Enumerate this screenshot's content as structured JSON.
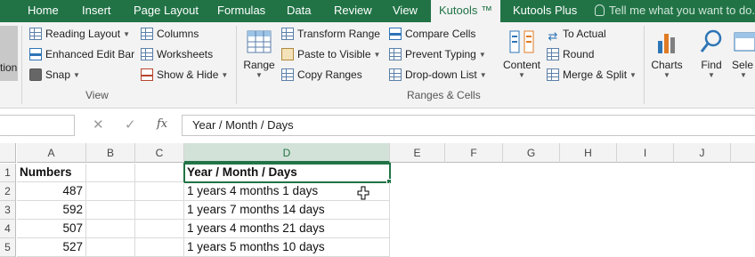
{
  "tabs": [
    "Home",
    "Insert",
    "Page Layout",
    "Formulas",
    "Data",
    "Review",
    "View",
    "Kutools ™",
    "Kutools Plus"
  ],
  "active_tab": "Kutools ™",
  "tell_me": "Tell me what you want to do...",
  "ribbon": {
    "left_cut_label": "tion",
    "view_group": {
      "items": [
        "Reading Layout",
        "Enhanced Edit Bar",
        "Snap",
        "Columns",
        "Worksheets",
        "Show & Hide"
      ],
      "label": "View"
    },
    "ranges_group": {
      "range_label": "Range",
      "items": [
        "Transform Range",
        "Paste to Visible",
        "Copy Ranges",
        "Compare Cells",
        "Prevent Typing",
        "Drop-down List"
      ],
      "label": "Ranges & Cells"
    },
    "content_group": {
      "content_label": "Content",
      "items": [
        "To Actual",
        "Round",
        "Merge & Split"
      ]
    },
    "charts_label": "Charts",
    "find_label": "Find",
    "select_label": "Sele"
  },
  "formula_bar": {
    "cancel": "✕",
    "enter": "✓",
    "fx": "fx",
    "value": "Year / Month / Days"
  },
  "columns": [
    "A",
    "B",
    "C",
    "D",
    "E",
    "F",
    "G",
    "H",
    "I",
    "J"
  ],
  "selected_column": "D",
  "rows": [
    {
      "num": "1",
      "a": "Numbers",
      "d": "Year / Month / Days"
    },
    {
      "num": "2",
      "a": "487",
      "d": "1 years 4 months 1 days"
    },
    {
      "num": "3",
      "a": "592",
      "d": "1 years 7 months 14 days"
    },
    {
      "num": "4",
      "a": "507",
      "d": "1 years 4 months 21 days"
    },
    {
      "num": "5",
      "a": "527",
      "d": "1 years 5 months 10 days"
    }
  ]
}
